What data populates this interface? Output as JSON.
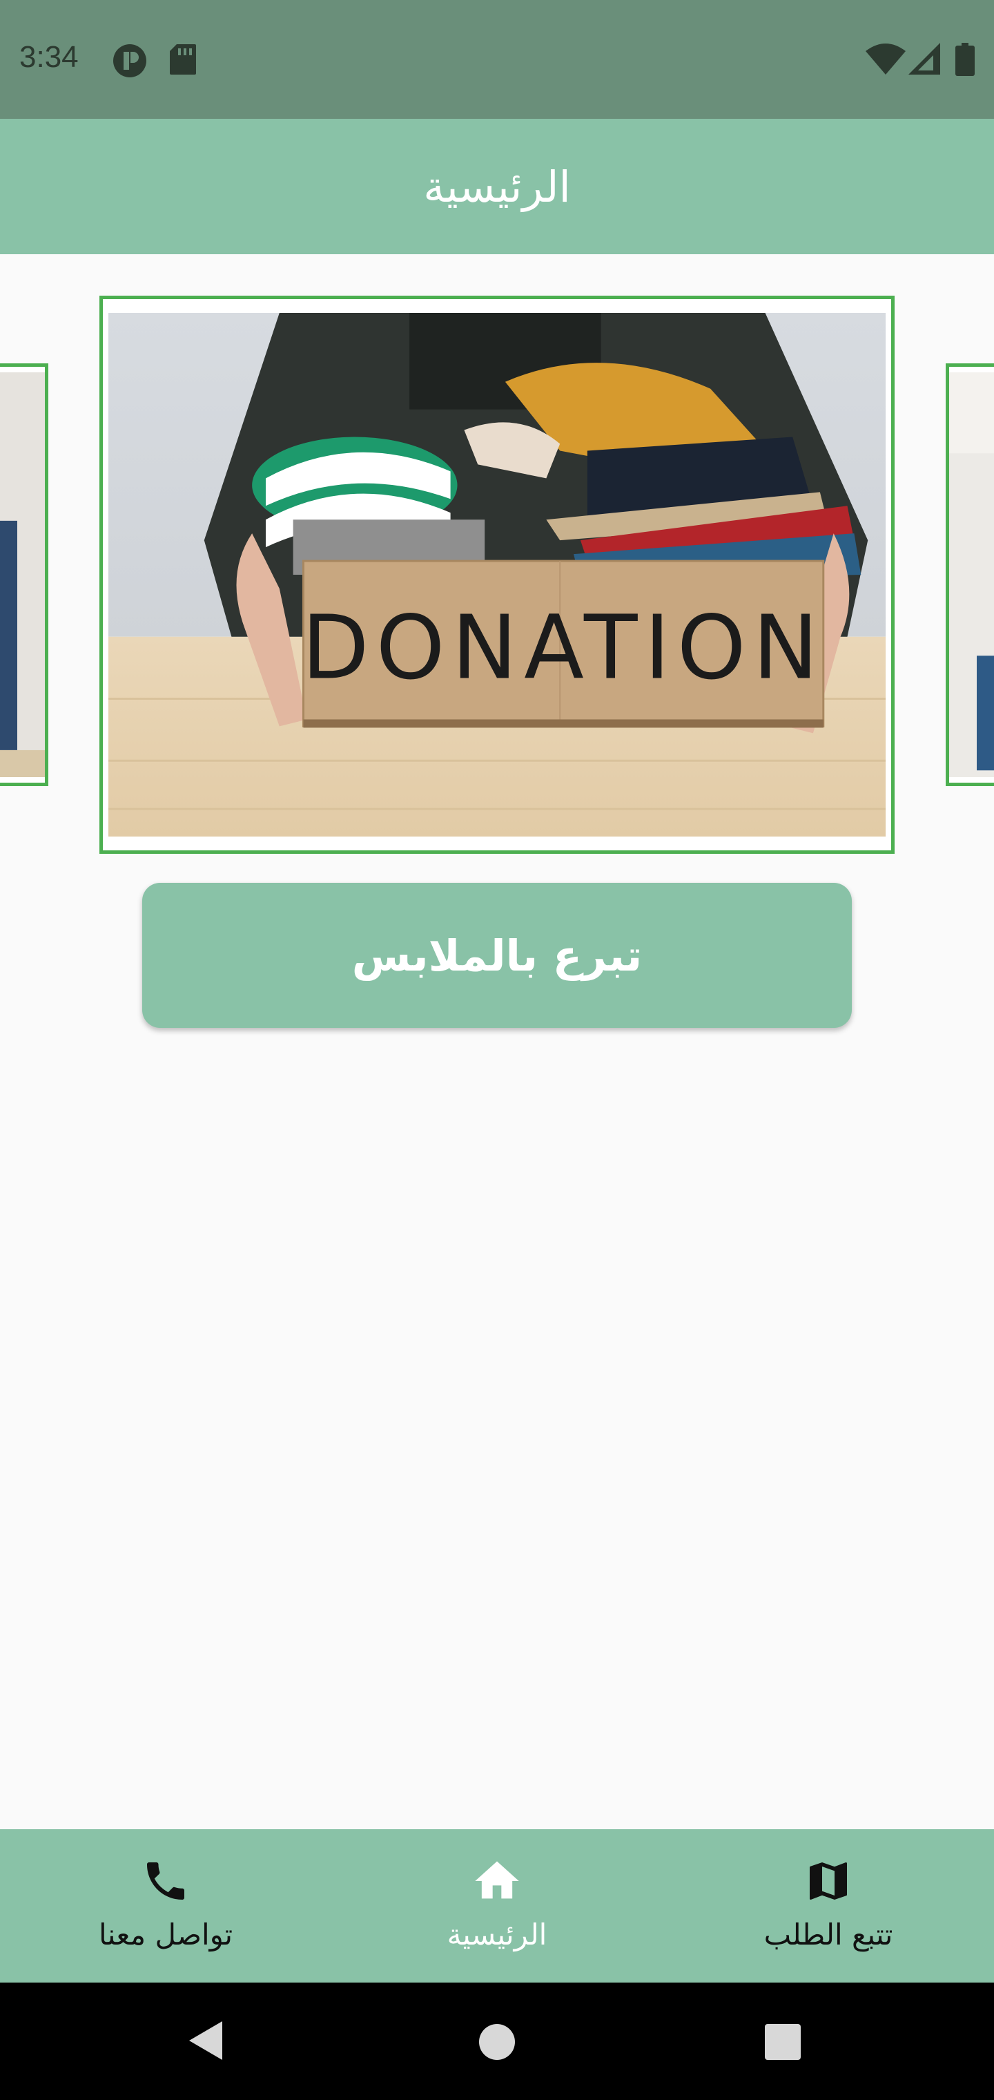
{
  "status_bar": {
    "time": "3:34",
    "icons": [
      "notification-p-icon",
      "sd-card-icon",
      "wifi-icon",
      "signal-icon",
      "battery-icon"
    ]
  },
  "app_bar": {
    "title": "الرئيسية"
  },
  "carousel": {
    "main_image_label": "DONATION",
    "border_color": "#4caf50"
  },
  "donate_button": {
    "label": "تبرع بالملابس"
  },
  "bottom_nav": {
    "items": [
      {
        "label": "تواصل معنا",
        "icon": "phone-icon"
      },
      {
        "label": "الرئيسية",
        "icon": "home-icon",
        "active": true
      },
      {
        "label": "تتبع الطلب",
        "icon": "map-icon"
      }
    ]
  },
  "colors": {
    "accent": "#89c2a7",
    "status_bar": "#6a8f7a",
    "card_border": "#4caf50"
  }
}
